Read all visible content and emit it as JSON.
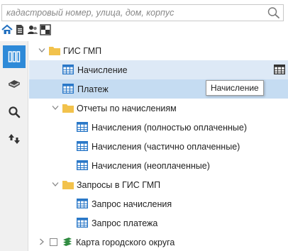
{
  "search": {
    "placeholder": "кадастровый номер, улица, дом, корпус",
    "icon": "search-icon"
  },
  "mini_toolbar": [
    "home-icon",
    "document-icon",
    "users-icon",
    "grid-icon"
  ],
  "side_bar": {
    "items": [
      "layers-grid-icon",
      "book-icon",
      "search-icon",
      "sort-arrows-icon"
    ],
    "active_index": 0
  },
  "tree": {
    "root": {
      "label": "ГИС ГМП",
      "expanded": true
    },
    "items": [
      {
        "label": "Начисление"
      },
      {
        "label": "Платеж"
      },
      {
        "label": "Отчеты по начислениям",
        "expanded": true
      },
      {
        "label": "Начисления (полностью оплаченные)"
      },
      {
        "label": "Начисления (частично оплаченные)"
      },
      {
        "label": "Начисления (неоплаченные)"
      },
      {
        "label": "Запросы в ГИС ГМП",
        "expanded": true
      },
      {
        "label": "Запрос начисления"
      },
      {
        "label": "Запрос платежа"
      },
      {
        "label": "Карта городского округа",
        "checked": false
      }
    ]
  },
  "tooltip": {
    "text": "Начисление"
  },
  "colors": {
    "accent": "#2e8ad8",
    "row_hover": "#dde9f6",
    "row_selected": "#c5dcf2",
    "folder": "#f2c24c",
    "table_icon": "#2a78c8",
    "map_layer": "#2d8a3e"
  }
}
